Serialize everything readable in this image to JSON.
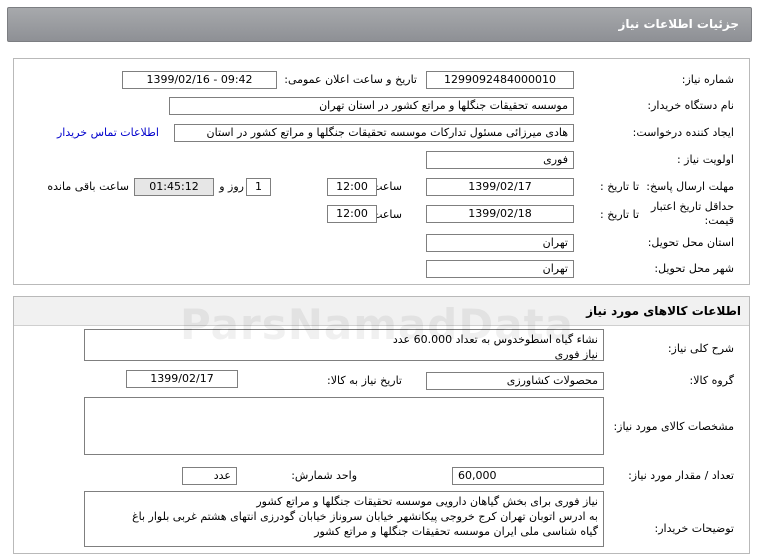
{
  "header": {
    "title": "جزئیات اطلاعات نیاز"
  },
  "main": {
    "need_number_label": "شماره نیاز:",
    "need_number": "1299092484000010",
    "announce_label": "تاریخ و ساعت اعلان عمومی:",
    "announce_value": "1399/02/16 - 09:42",
    "buyer_label": "نام دستگاه خریدار:",
    "buyer_value": "موسسه تحقیقات جنگلها و مراتع کشور در استان تهران",
    "creator_label": "ایجاد کننده درخواست:",
    "creator_value": "هادی میرزائی مسئول تدارکات موسسه تحقیقات جنگلها و مراتع کشور در استان",
    "contact_link": "اطلاعات تماس خریدار",
    "priority_label": "اولویت نیاز :",
    "priority_value": "فوری",
    "send_deadline_label": "مهلت ارسال پاسخ:",
    "to_date_label": "تا تاریخ :",
    "send_date": "1399/02/17",
    "time_label": "ساعت",
    "send_time": "12:00",
    "days_value": "1",
    "days_label": "روز و",
    "remaining_time": "01:45:12",
    "remaining_label": "ساعت باقی مانده",
    "validity_label_1": "حداقل تاریخ اعتبار",
    "validity_label_2": "قیمت:",
    "validity_date": "1399/02/18",
    "validity_time": "12:00",
    "province_label": "استان محل تحویل:",
    "province_value": "تهران",
    "city_label": "شهر محل تحویل:",
    "city_value": "تهران"
  },
  "goods": {
    "title": "اطلاعات کالاهای مورد نیاز",
    "desc_label": "شرح کلی نیاز:",
    "desc_line1": "نشاء گیاه اسطوخدوس به تعداد 60.000 عدد",
    "desc_line2": "نیاز فوری",
    "group_label": "گروه کالا:",
    "group_value": "محصولات کشاورزی",
    "need_date_label": "تاریخ نیاز به کالا:",
    "need_date": "1399/02/17",
    "specs_label": "مشخصات کالای مورد نیاز:",
    "qty_label": "تعداد / مقدار مورد نیاز:",
    "qty_value": "60,000",
    "unit_label": "واحد شمارش:",
    "unit_value": "عدد",
    "buyer_notes_label": "توضیحات خریدار:",
    "notes_line1": "نیاز فوری برای بخش گیاهان دارویی موسسه تحقیقات جنگلها و مراتع کشور",
    "notes_line2": "به ادرس اتوبان تهران کرج خروجی پیکانشهر خیابان سرو‌ناز خیابان گودرزی انتهای هشتم غربی بلوار باغ",
    "notes_line3": "گیاه شناسی ملی ایران موسسه تحقیقات جنگلها و مراتع کشور"
  }
}
